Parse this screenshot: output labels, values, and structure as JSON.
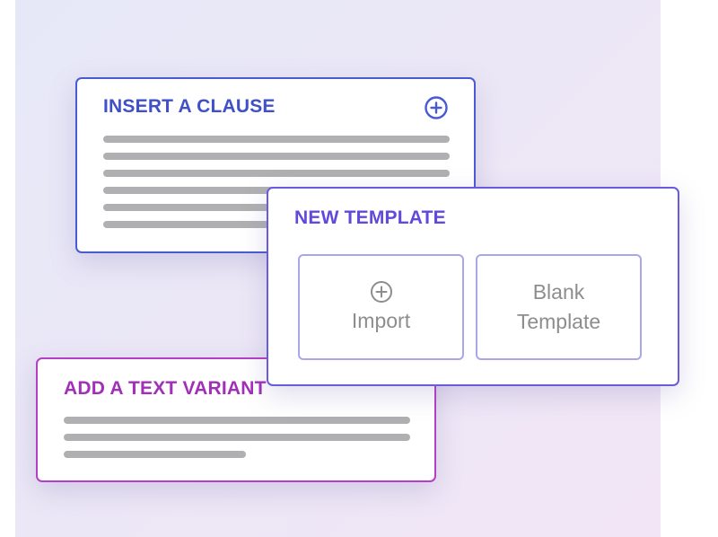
{
  "cards": {
    "insert_clause": {
      "title": "INSERT A CLAUSE",
      "action_icon": "plus-circle-icon",
      "accent_color": "#4a5ad1"
    },
    "new_template": {
      "title": "NEW TEMPLATE",
      "accent_color": "#6a5ae0",
      "options": [
        {
          "label": "Import",
          "icon": "plus-circle-icon"
        },
        {
          "label_line1": "Blank",
          "label_line2": "Template"
        }
      ]
    },
    "text_variant": {
      "title": "ADD A TEXT VARIANT",
      "accent_color": "#b43ec6"
    }
  }
}
